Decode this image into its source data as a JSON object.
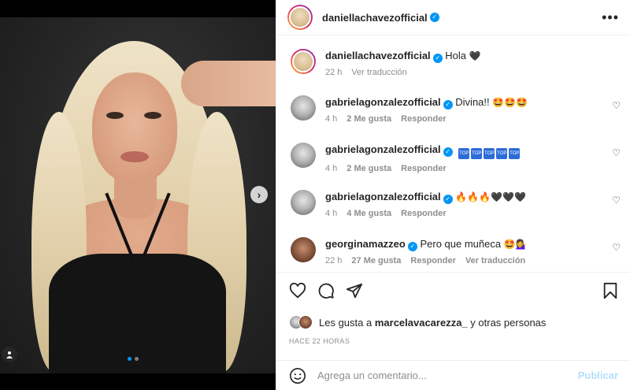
{
  "post": {
    "author": "daniellachavezofficial",
    "verified": true,
    "caption": "Hola",
    "caption_emoji": "🖤",
    "caption_age": "22 h",
    "see_translation": "Ver traducción",
    "media_slide": 1,
    "media_total": 2
  },
  "comments": [
    {
      "user": "gabrielagonzalezofficial",
      "text": "Divina!!",
      "emoji": "🤩🤩🤩",
      "age": "4 h",
      "likes": "2 Me gusta",
      "reply": "Responder"
    },
    {
      "user": "gabrielagonzalezofficial",
      "text": "",
      "emoji": "",
      "age": "4 h",
      "likes": "2 Me gusta",
      "reply": "Responder",
      "badges": [
        "TOP",
        "TOP",
        "TOP",
        "TOP",
        "TOP"
      ]
    },
    {
      "user": "gabrielagonzalezofficial",
      "text": "",
      "emoji": "🔥🔥🔥🖤🖤🖤",
      "age": "4 h",
      "likes": "4 Me gusta",
      "reply": "Responder"
    },
    {
      "user": "georginamazzeo",
      "text": "Pero que muñeca",
      "emoji": "🤩💁‍♀️",
      "age": "22 h",
      "likes": "27 Me gusta",
      "reply": "Responder",
      "see_translation": "Ver traducción"
    }
  ],
  "likes": {
    "prefix": "Les gusta a",
    "user": "marcelavacarezza_",
    "suffix": "y otras personas"
  },
  "timestamp": "HACE 22 HORAS",
  "composer": {
    "placeholder": "Agrega un comentario...",
    "post_label": "Publicar"
  },
  "colors": {
    "accent": "#0095f6",
    "post_disabled": "#b2dffc",
    "muted": "#8e8e8e"
  }
}
